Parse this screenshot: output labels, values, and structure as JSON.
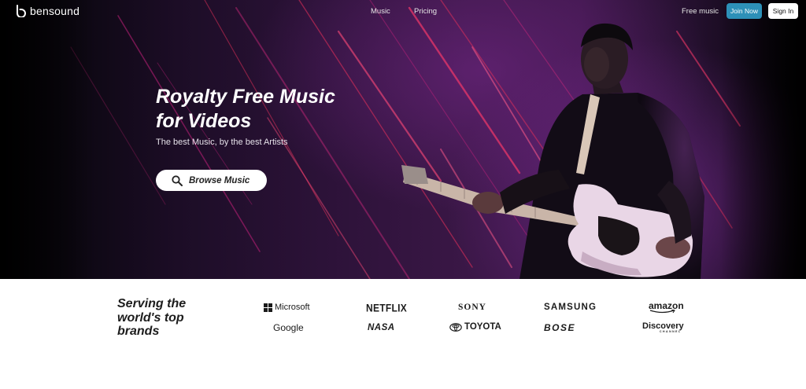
{
  "nav": {
    "logo_text": "bensound",
    "links": [
      "Music",
      "Pricing"
    ],
    "free_music": "Free music",
    "join": "Join Now",
    "sign_in": "Sign In"
  },
  "hero": {
    "title_line1": "Royalty Free Music",
    "title_line2": "for Videos",
    "subtitle": "The best Music, by the best Artists",
    "browse_label": "Browse Music"
  },
  "brands": {
    "heading_line1": "Serving the",
    "heading_line2": "world's top",
    "heading_line3": "brands",
    "logos": {
      "microsoft": "Microsoft",
      "netflix": "NETFLIX",
      "sony": "SONY",
      "samsung": "SAMSUNG",
      "amazon": "amazon",
      "google": "Google",
      "nasa": "NASA",
      "toyota": "TOYOTA",
      "bose": "BOSE",
      "discovery": "Discovery",
      "discovery_sub": "CHANNEL"
    }
  },
  "colors": {
    "join_button": "#2d90b8",
    "hero_purple": "#3a1746",
    "stripe_red": "#e8305a"
  },
  "icons": [
    "bensound-logo-icon",
    "search-icon",
    "microsoft-logo-icon",
    "toyota-logo-icon",
    "amazon-smile-icon"
  ]
}
